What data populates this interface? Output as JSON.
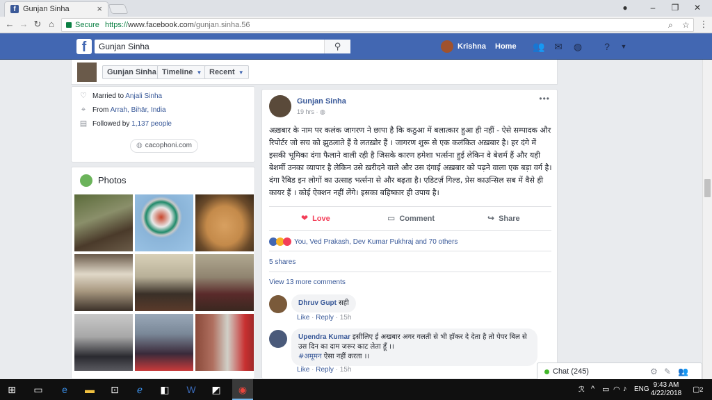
{
  "browser": {
    "tab_title": "Gunjan Sinha",
    "secure_label": "Secure",
    "url_scheme": "https://",
    "url_host": "www.facebook.com",
    "url_path": "/gunjan.sinha.56"
  },
  "fb_header": {
    "logo": "f",
    "search_value": "Gunjan Sinha",
    "user_name": "Krishna",
    "home_label": "Home",
    "brand_color": "#4267b2"
  },
  "profile_nav": {
    "name": "Gunjan Sinha",
    "timeline_label": "Timeline",
    "recent_label": "Recent"
  },
  "intro": {
    "married_prefix": "Married to",
    "married_name": "Anjali Sinha",
    "from_prefix": "From",
    "from_place": "Arrah, Bihār, India",
    "followed_prefix": "Followed by",
    "followed_count": "1,137 people",
    "website": "cacophoni.com"
  },
  "photos": {
    "title": "Photos",
    "count": 9
  },
  "post": {
    "author": "Gunjan Sinha",
    "time": "19 hrs",
    "text": "अख़बार के नाम पर कलंक जागरण ने छापा है कि कठुआ में बलात्कार हुआ ही नहीं - ऐसे सम्पादक और रिपोर्टर जो सच को झुठलाते हैं वे लतख़ोर हैं । जागरण शुरू से एक कलंकित अख़बार है। हर दंगे में इसकी भूमिका दंगा फैलाने वाली रही है जिसके कारण हमेशा भर्त्सना हुई लेकिन वे बेशर्म हैं और यही बेशर्मी उनका व्यापार है लेकिन उसे ख़रीदने वाले और उस दंगाई अख़बार को पढ़ने वाला एक बड़ा वर्ग है। दंगा रैबिड इन लोगों का उत्साह भर्त्सना से और बढ़ता है। एडिटर्ज़ गिल्ड, प्रेस काउन्सिल सब में वैसे ही कायर हैं । कोई ऐक्शन नहीं लेंगे। इसका बहिष्कार ही उपाय है।",
    "love_label": "Love",
    "comment_label": "Comment",
    "share_label": "Share",
    "reactions_text": "You, Ved Prakash, Dev Kumar Pukhraj and 70 others",
    "shares_text": "5 shares",
    "more_comments": "View 13 more comments"
  },
  "comments": [
    {
      "name": "Dhruv Gupt",
      "text": "सही",
      "like": "Like",
      "reply": "Reply",
      "time": "15h"
    },
    {
      "name": "Upendra Kumar",
      "text": "इसीलिए ई अखबार अगर गलती से भी हॉकर दे देता है तो पेपर बिल से उस दिन का दाम जरूर काट लेता हूँ ।।",
      "tag": "#अमूमन",
      "tag_text": "ऐसा नहीं करता ।।",
      "like": "Like",
      "reply": "Reply",
      "time": "15h"
    }
  ],
  "chat": {
    "label": "Chat (245)"
  },
  "taskbar": {
    "time": "9:43 AM",
    "date": "4/22/2018",
    "lang": "ENG",
    "notifications": "2"
  }
}
